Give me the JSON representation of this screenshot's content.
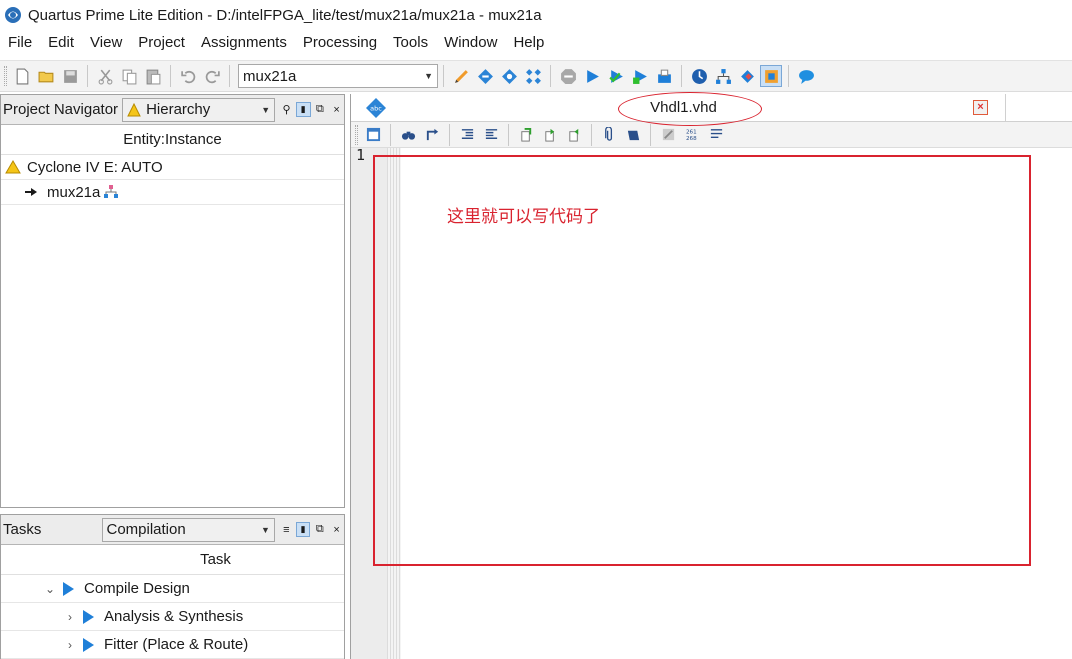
{
  "titlebar": {
    "title": "Quartus Prime Lite Edition - D:/intelFPGA_lite/test/mux21a/mux21a - mux21a"
  },
  "menu": [
    "File",
    "Edit",
    "View",
    "Project",
    "Assignments",
    "Processing",
    "Tools",
    "Window",
    "Help"
  ],
  "toolbar": {
    "revision": "mux21a"
  },
  "project_navigator": {
    "title": "Project Navigator",
    "view_selector": "Hierarchy",
    "column_header": "Entity:Instance",
    "device": "Cyclone IV E: AUTO",
    "top_entity": "mux21a"
  },
  "tasks": {
    "title": "Tasks",
    "flow_selector": "Compilation",
    "column_header": "Task",
    "items": [
      {
        "label": "Compile Design",
        "state": "expanded"
      },
      {
        "label": "Analysis & Synthesis",
        "state": "collapsed"
      },
      {
        "label": "Fitter (Place & Route)",
        "state": "collapsed"
      }
    ]
  },
  "editor": {
    "tab_title": "Vhdl1.vhd",
    "line_numbers": [
      "1"
    ],
    "annotation": "这里就可以写代码了"
  },
  "colors": {
    "highlight_red": "#d9232f",
    "play_blue": "#1f7fd8",
    "toolbar_bg": "#f3f3f3"
  }
}
